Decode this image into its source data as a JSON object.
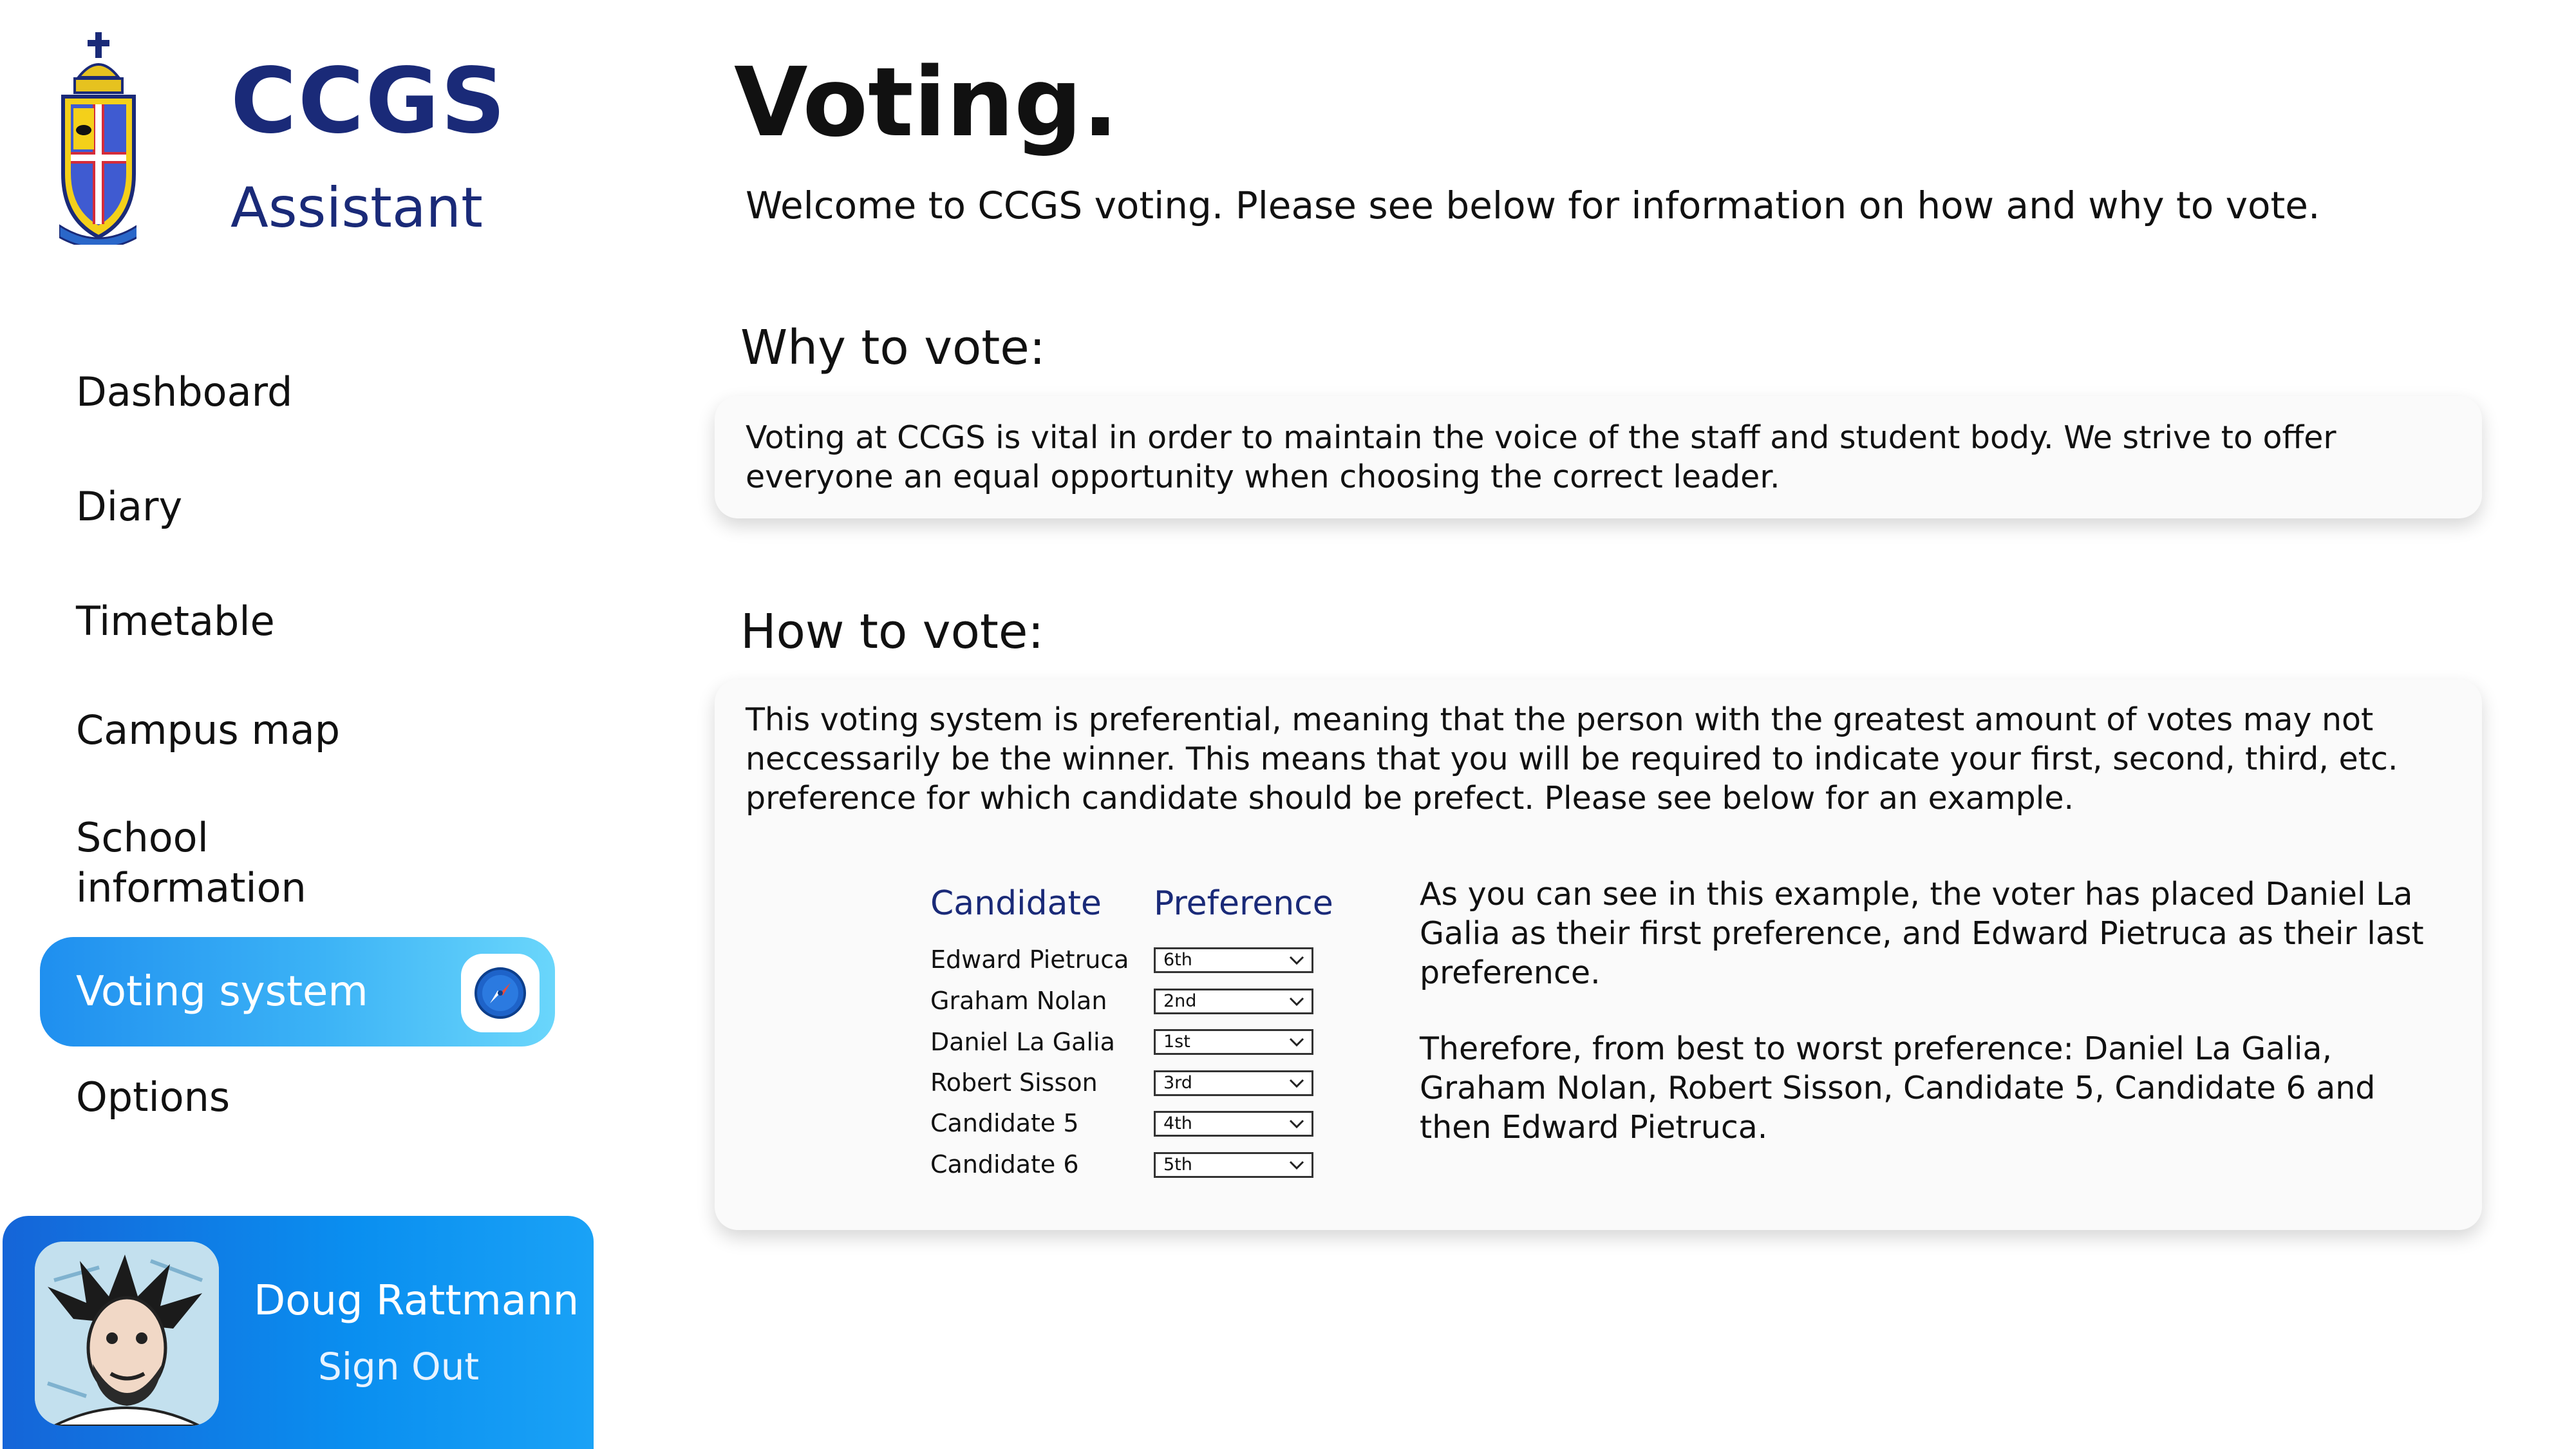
{
  "brand": {
    "title": "CCGS",
    "subtitle": "Assistant"
  },
  "sidebar": {
    "items": [
      {
        "label": "Dashboard",
        "active": false
      },
      {
        "label": "Diary",
        "active": false
      },
      {
        "label": "Timetable",
        "active": false
      },
      {
        "label": "Campus map",
        "active": false
      },
      {
        "label": "School information",
        "active": false
      },
      {
        "label": "Voting system",
        "active": true,
        "icon": "compass-icon"
      },
      {
        "label": "Options",
        "active": false
      }
    ]
  },
  "user": {
    "name": "Doug Rattmann",
    "sign_out": "Sign Out"
  },
  "main": {
    "title": "Voting.",
    "intro": "Welcome to CCGS voting. Please see below for information on how and why to vote.",
    "why": {
      "heading": "Why to vote:",
      "text": "Voting at CCGS is vital in order to maintain the voice of the staff and student body. We strive to offer everyone an equal opportunity when choosing the correct leader."
    },
    "how": {
      "heading": "How to vote:",
      "text": "This voting system is preferential, meaning that the person with the greatest amount of votes may not neccessarily be the winner. This means that you will be required to indicate your first, second, third, etc. preference for which candidate should be prefect. Please see below for an example.",
      "table": {
        "headers": {
          "candidate": "Candidate",
          "preference": "Preference"
        },
        "rows": [
          {
            "candidate": "Edward Pietruca",
            "preference": "6th"
          },
          {
            "candidate": "Graham Nolan",
            "preference": "2nd"
          },
          {
            "candidate": "Daniel La Galia",
            "preference": "1st"
          },
          {
            "candidate": "Robert Sisson",
            "preference": "3rd"
          },
          {
            "candidate": "Candidate 5",
            "preference": "4th"
          },
          {
            "candidate": "Candidate 6",
            "preference": "5th"
          }
        ]
      },
      "example_p1": "As you can see in this example, the voter has placed Daniel La Galia as their first preference, and Edward Pietruca as their last preference.",
      "example_p2": "Therefore, from best to worst preference: Daniel La Galia, Graham Nolan, Robert Sisson, Candidate 5, Candidate 6 and then Edward Pietruca."
    }
  },
  "colors": {
    "brand_navy": "#1a2a78",
    "active_gradient_start": "#1f8fef",
    "active_gradient_end": "#6ad6fb",
    "user_panel": "#0a8ff0",
    "card_bg": "#fafafa"
  }
}
